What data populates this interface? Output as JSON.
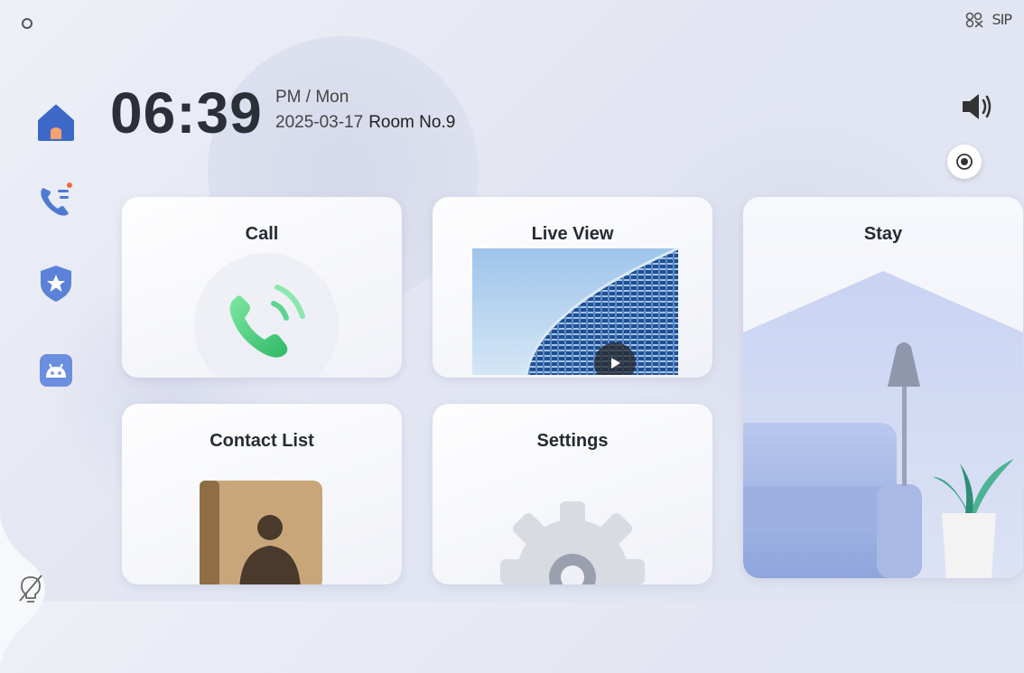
{
  "clock": {
    "time": "06:39",
    "period_day": "PM / Mon",
    "date": "2025-03-17",
    "room": "Room No.9"
  },
  "status": {
    "sip": "SIP"
  },
  "cards": {
    "call": "Call",
    "live_view": "Live View",
    "stay": "Stay",
    "contact_list": "Contact List",
    "settings": "Settings"
  },
  "colors": {
    "call_green": "#3fc97a",
    "nav_blue": "#3e68c8",
    "accent_orange": "#ef6b3c"
  },
  "icons": {
    "sidebar": [
      "home-icon",
      "call-log-icon",
      "shield-star-icon",
      "android-apps-icon",
      "light-off-icon"
    ],
    "header": [
      "volume-icon",
      "record-icon"
    ]
  }
}
